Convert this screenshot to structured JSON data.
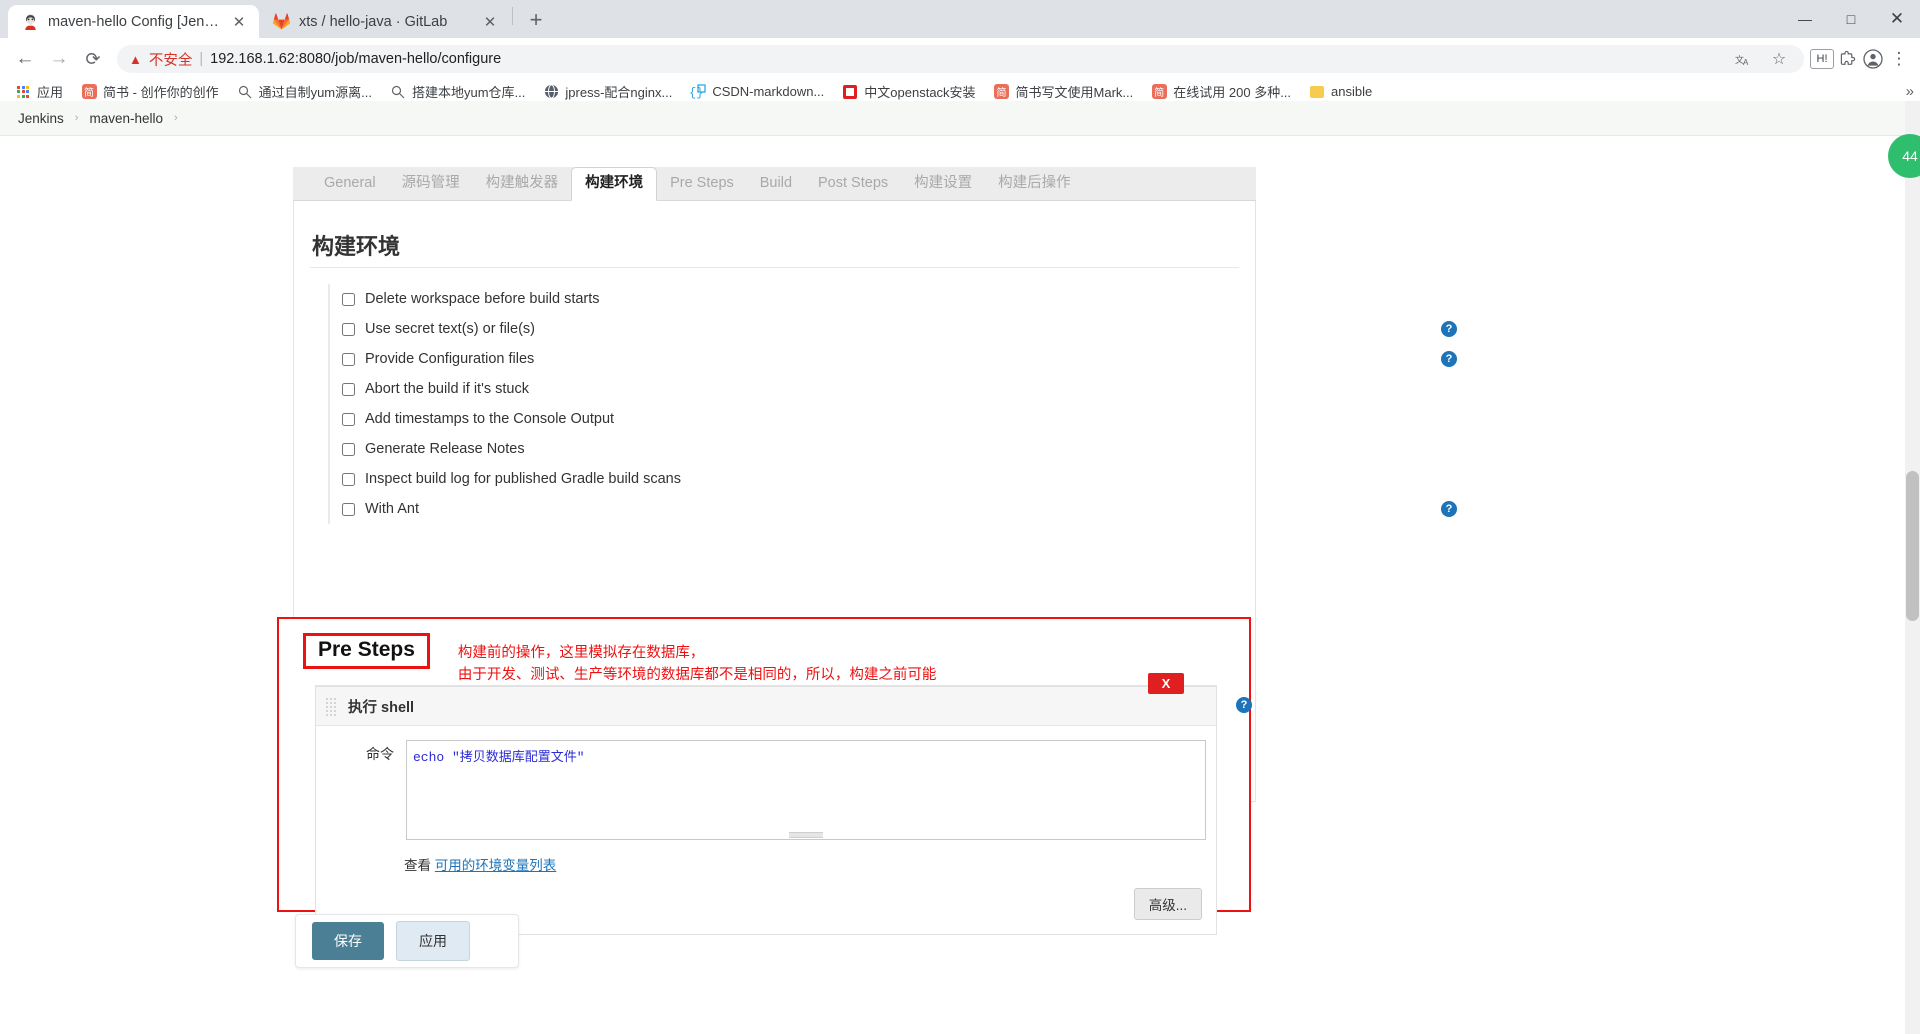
{
  "browser": {
    "tabs": [
      {
        "title": "maven-hello Config [Jenkins]",
        "icon": "jenkins-favicon",
        "active": true,
        "close": "✕"
      },
      {
        "title": "xts / hello-java · GitLab",
        "icon": "gitlab-favicon",
        "active": false,
        "close": "✕"
      }
    ],
    "newtab_label": "+",
    "window_controls": {
      "minimize": "—",
      "maximize": "□",
      "close": "✕"
    },
    "nav": {
      "back": "←",
      "forward": "→",
      "reload": "⟳"
    },
    "omnibox": {
      "warning_icon": "warning-triangle-icon",
      "insecure_label": "不安全",
      "separator": "|",
      "url": "192.168.1.62:8080/job/maven-hello/configure",
      "translate_icon": "translate-icon",
      "star_icon": "☆",
      "extension_badge": "H!",
      "puzzle_icon": "extensions-icon",
      "profile_icon": "profile-icon",
      "menu_icon": "⋮"
    },
    "bookmarks": [
      {
        "label": "应用",
        "icon": "apps-grid-icon"
      },
      {
        "label": "简书 - 创作你的创作",
        "icon": "jianshu-icon"
      },
      {
        "label": "通过自制yum源离...",
        "icon": "search-icon"
      },
      {
        "label": "搭建本地yum仓库...",
        "icon": "search-icon"
      },
      {
        "label": "jpress-配合nginx...",
        "icon": "globe-icon"
      },
      {
        "label": "CSDN-markdown...",
        "icon": "code-icon"
      },
      {
        "label": "中文openstack安装",
        "icon": "openstack-icon"
      },
      {
        "label": "简书写文使用Mark...",
        "icon": "jianshu-icon"
      },
      {
        "label": "在线试用 200 多种...",
        "icon": "jianshu-icon"
      },
      {
        "label": "ansible",
        "icon": "folder-icon"
      }
    ],
    "bookmarks_overflow": "»"
  },
  "jenkins": {
    "breadcrumb": [
      {
        "label": "Jenkins"
      },
      {
        "label": "maven-hello"
      }
    ],
    "breadcrumb_sep": "›",
    "config_tabs": [
      {
        "label": "General",
        "active": false
      },
      {
        "label": "源码管理",
        "active": false
      },
      {
        "label": "构建触发器",
        "active": false
      },
      {
        "label": "构建环境",
        "active": true
      },
      {
        "label": "Pre Steps",
        "active": false
      },
      {
        "label": "Build",
        "active": false
      },
      {
        "label": "Post Steps",
        "active": false
      },
      {
        "label": "构建设置",
        "active": false
      },
      {
        "label": "构建后操作",
        "active": false
      }
    ],
    "section_title": "构建环境",
    "build_env_options": [
      {
        "label": "Delete workspace before build starts",
        "checked": false,
        "help": false
      },
      {
        "label": "Use secret text(s) or file(s)",
        "checked": false,
        "help": true
      },
      {
        "label": "Provide Configuration files",
        "checked": false,
        "help": true
      },
      {
        "label": "Abort the build if it's stuck",
        "checked": false,
        "help": false
      },
      {
        "label": "Add timestamps to the Console Output",
        "checked": false,
        "help": false
      },
      {
        "label": "Generate Release Notes",
        "checked": false,
        "help": false
      },
      {
        "label": "Inspect build log for published Gradle build scans",
        "checked": false,
        "help": false
      },
      {
        "label": "With Ant",
        "checked": false,
        "help": true
      }
    ],
    "help_glyph": "?",
    "pre_steps": {
      "title": "Pre Steps",
      "annotation": "构建前的操作，这里模拟存在数据库，\n由于开发、测试、生产等环境的数据库都不是相同的，所以，构建之前可能\n涉及到替换数据库配置文件、连接信息等操作",
      "step": {
        "name": "执行 shell",
        "delete_label": "X",
        "help_glyph": "?",
        "command_label": "命令",
        "command_value": "echo \"拷贝数据库配置文件\"",
        "env_prefix": "查看 ",
        "env_link": "可用的环境变量列表",
        "advanced_label": "高级..."
      }
    },
    "footer": {
      "save_label": "保存",
      "apply_label": "应用"
    },
    "notification_badge": "44"
  },
  "colors": {
    "red_annotation": "#ee1111",
    "jenkins_save": "#4b7f96",
    "link_blue": "#1d74b8",
    "command_text": "#2b2bd8"
  }
}
